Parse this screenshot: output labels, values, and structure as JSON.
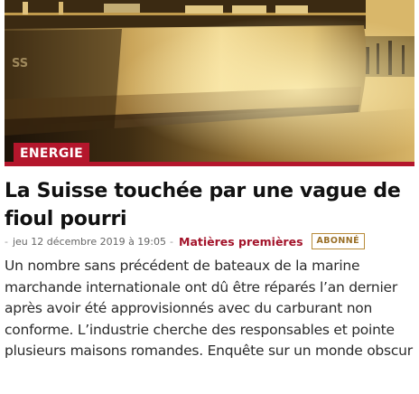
{
  "article": {
    "category": "Energie",
    "headline": "La Suisse touchée par une vague de fioul pourri",
    "meta": {
      "bullet": "-",
      "date": "jeu 12 décembre 2019 à 19:05",
      "separator": "-",
      "topic": "Matières premières",
      "badge": "ABONNÉ"
    },
    "lead": "Un nombre sans précédent de bateaux de la marine marchande internationale ont dû être réparés l’an dernier après avoir été approvisionnés avec du carburant non conforme. L’industrie cherche des responsables et pointe plusieurs maisons romandes. Enquête sur un monde obscur"
  },
  "colors": {
    "accent": "#b4162c",
    "badge_border": "#b88c3a"
  },
  "icons": {
    "hero": "ship-hull-photo"
  }
}
